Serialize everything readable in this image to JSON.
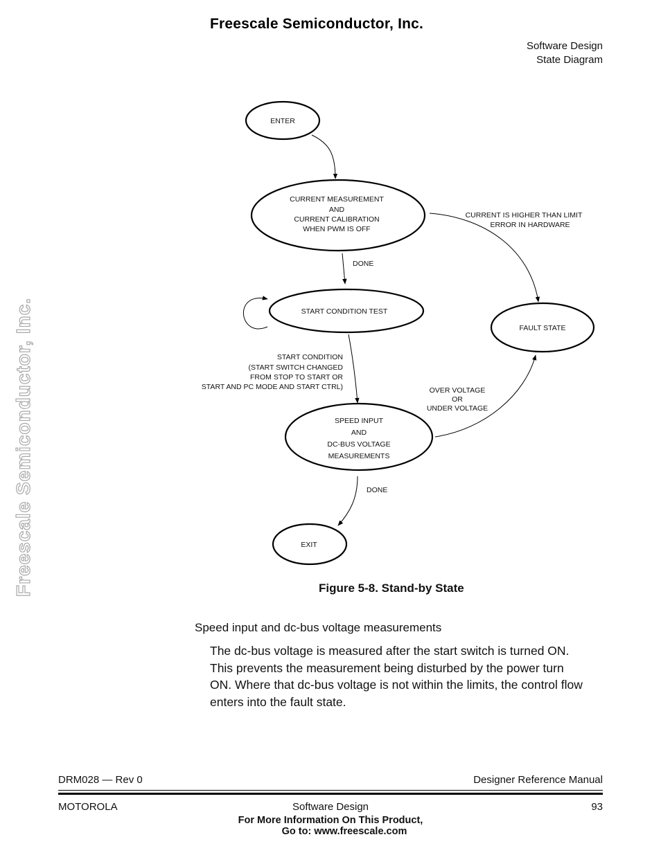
{
  "header": {
    "brand": "Freescale Semiconductor, Inc.",
    "section": "Software Design",
    "subsection": "State Diagram"
  },
  "watermark": "Freescale Semiconductor, Inc.",
  "diagram": {
    "states": {
      "enter": [
        "ENTER"
      ],
      "current_meas": [
        "CURRENT MEASUREMENT",
        "AND",
        "CURRENT CALIBRATION",
        "WHEN PWM IS OFF"
      ],
      "start_test": [
        "START CONDITION TEST"
      ],
      "fault": [
        "FAULT STATE"
      ],
      "speed_input": [
        "SPEED INPUT",
        "AND",
        "DC-BUS VOLTAGE",
        "MEASUREMENTS"
      ],
      "exit": [
        "EXIT"
      ]
    },
    "transitions": {
      "done1": "DONE",
      "current_limit": [
        "CURRENT IS HIGHER THAN LIMIT",
        "ERROR IN HARDWARE"
      ],
      "start_condition": [
        "START CONDITION",
        "(START SWITCH CHANGED",
        "FROM STOP TO START OR",
        "START AND PC MODE AND START CTRL)"
      ],
      "voltage": [
        "OVER VOLTAGE",
        "OR",
        "UNDER VOLTAGE"
      ],
      "done2": "DONE"
    }
  },
  "caption": "Figure 5-8. Stand-by State",
  "body": {
    "subheading": "Speed input and dc-bus voltage measurements",
    "paragraph_lines": [
      "The dc-bus voltage is measured after the start switch is turned ON.",
      "This prevents the measurement being disturbed by the power turn",
      "ON. Where that dc-bus voltage is not within the limits, the control flow",
      "enters into the fault state."
    ]
  },
  "footer": {
    "doc_id": "DRM028 — Rev 0",
    "manual": "Designer Reference Manual",
    "company": "MOTOROLA",
    "section": "Software Design",
    "page": "93",
    "more_info_1": "For More Information On This Product,",
    "more_info_2": "Go to: www.freescale.com"
  }
}
